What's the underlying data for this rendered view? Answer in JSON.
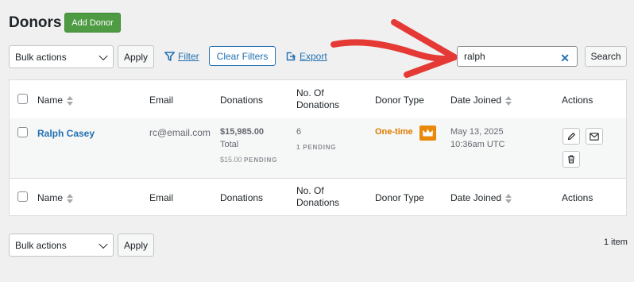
{
  "page": {
    "title": "Donors",
    "add_button": "Add Donor"
  },
  "toolbar": {
    "bulk_actions": "Bulk actions",
    "apply": "Apply",
    "filter": "Filter",
    "clear_filters": "Clear Filters",
    "export": "Export",
    "search_value": "ralph",
    "search_button": "Search"
  },
  "columns": {
    "name": "Name",
    "email": "Email",
    "donations": "Donations",
    "no_of_donations_line1": "No. Of",
    "no_of_donations_line2": "Donations",
    "donor_type": "Donor Type",
    "date_joined": "Date Joined",
    "actions": "Actions"
  },
  "rows": [
    {
      "name": "Ralph Casey",
      "email": "rc@email.com",
      "donations_amount": "$15,985.00",
      "donations_total_label": "Total",
      "pending_amount": "$15.00",
      "pending_label": "PENDING",
      "count": "6",
      "count_pending": "1 PENDING",
      "donor_type": "One-time",
      "date": "May 13, 2025",
      "time": "10:36am UTC"
    }
  ],
  "footer": {
    "bulk_actions": "Bulk actions",
    "apply": "Apply",
    "item_count": "1 item"
  },
  "colors": {
    "accent": "#2271b1",
    "add_button": "#4e9b43",
    "one_time": "#e07b00",
    "annotation_arrow": "#e53935"
  },
  "icons": [
    "filter-icon",
    "export-icon",
    "clear-icon",
    "crown-icon",
    "edit-icon",
    "email-icon",
    "trash-icon",
    "sort-icon"
  ]
}
